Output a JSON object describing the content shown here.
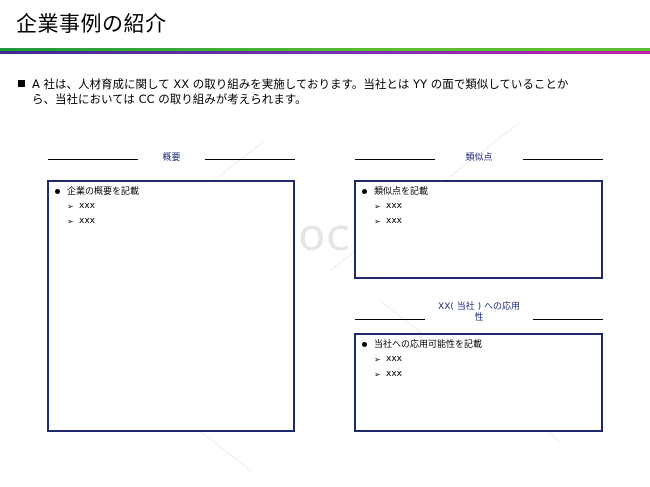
{
  "slide": {
    "title": "企業事例の紹介",
    "intro_line1": "A 社は、人材育成に関して XX の取り組みを実施しております。当社とは YY の面で類似していることか",
    "intro_line2": "ら、当社においては CC の取り組みが考えられます。"
  },
  "watermark": "bizocean",
  "sections": {
    "overview": {
      "label": "概要",
      "bullet": "企業の概要を記載",
      "sub": [
        "xxx",
        "xxx"
      ]
    },
    "similarity": {
      "label": "類似点",
      "bullet": "類似点を記載",
      "sub": [
        "xxx",
        "xxx"
      ]
    },
    "application": {
      "label_line1": "XX( 当社 ) への応用",
      "label_line2": "性",
      "bullet": "当社への応用可能性を記載",
      "sub": [
        "xxx",
        "xxx"
      ]
    }
  },
  "colors": {
    "accent_green": "#1f9a3a",
    "accent_purple": "#7b2fb5",
    "box_border": "#1f2a6a",
    "label_color": "#1f2a7a"
  }
}
